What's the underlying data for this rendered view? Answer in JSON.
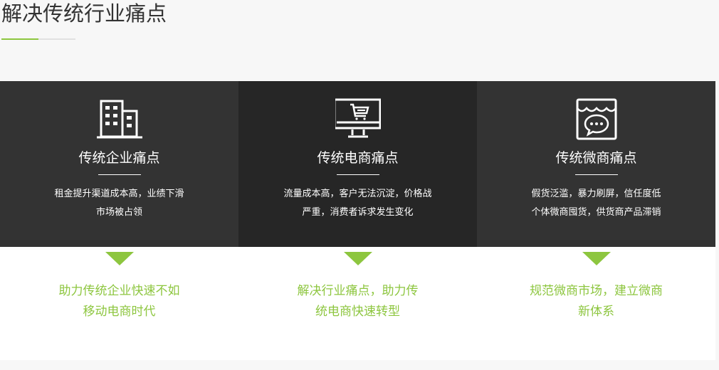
{
  "section": {
    "title": "解决传统行业痛点"
  },
  "colors": {
    "accent": "#8dc63f",
    "dark_panel": "#333333",
    "darker_panel": "#262626"
  },
  "panels": [
    {
      "icon": "building-icon",
      "heading": "传统企业痛点",
      "desc_lines": [
        "租金提升渠道成本高，业绩下滑",
        "市场被占领"
      ],
      "solution_lines": [
        "助力传统企业快速不如",
        "移动电商时代"
      ]
    },
    {
      "icon": "monitor-cart-icon",
      "heading": "传统电商痛点",
      "desc_lines": [
        "流量成本高，客户无法沉淀，价格战",
        "严重，消费者诉求发生变化"
      ],
      "solution_lines": [
        "解决行业痛点，助力传",
        "统电商快速转型"
      ]
    },
    {
      "icon": "shop-chat-icon",
      "heading": "传统微商痛点",
      "desc_lines": [
        "假货泛滥，暴力刷屏，信任度低",
        "个体微商囤货，供货商产品滞销"
      ],
      "solution_lines": [
        "规范微商市场，建立微商",
        "新体系"
      ]
    }
  ]
}
